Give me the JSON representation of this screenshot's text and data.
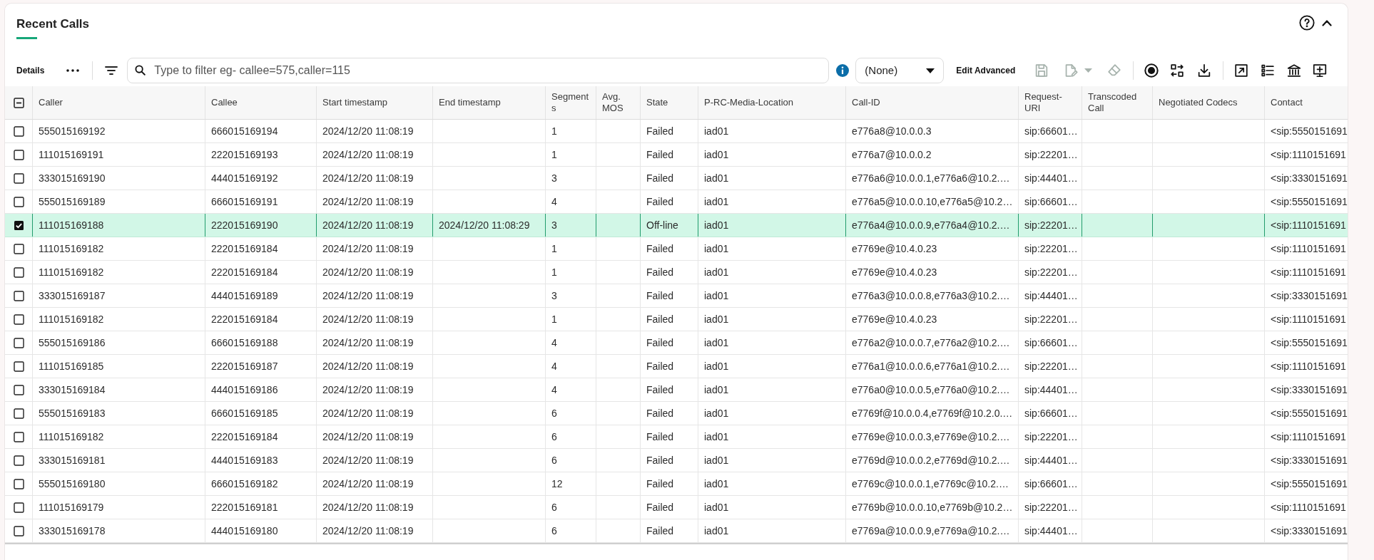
{
  "panel": {
    "title": "Recent Calls",
    "expanded": true
  },
  "toolbar": {
    "details_label": "Details",
    "filter": {
      "placeholder": "Type to filter eg- callee=575,caller=115"
    },
    "view_select": {
      "value": "(None)"
    },
    "edit_advanced": "Edit Advanced",
    "action_groups": [
      [
        {
          "kind": "save",
          "disabled": true,
          "menu": false
        },
        {
          "kind": "edit",
          "disabled": true,
          "menu": true
        },
        {
          "kind": "erase",
          "disabled": true,
          "menu": false
        }
      ],
      [
        {
          "kind": "record",
          "disabled": false,
          "menu": false
        },
        {
          "kind": "swap",
          "disabled": false,
          "menu": false
        },
        {
          "kind": "download",
          "disabled": false,
          "menu": false
        }
      ],
      [
        {
          "kind": "expand",
          "disabled": false,
          "menu": false
        },
        {
          "kind": "list",
          "disabled": false,
          "menu": false
        },
        {
          "kind": "bank",
          "disabled": false,
          "menu": false
        },
        {
          "kind": "add",
          "disabled": false,
          "menu": false
        }
      ]
    ]
  },
  "table": {
    "select_all": {
      "partial": true
    },
    "columns": [
      "Caller",
      "Callee",
      "Start timestamp",
      "End timestamp",
      "Segments",
      "Avg. MOS",
      "State",
      "P-RC-Media-Location",
      "Call-ID",
      "Request-URI",
      "Transcoded Call",
      "Negotiated Codecs",
      "Contact"
    ],
    "rows": [
      {
        "selected": false,
        "caller": "555015169192",
        "callee": "666015169194",
        "start_timestamp": "2024/12/20 11:08:19",
        "segments": "1",
        "state": "Failed",
        "p_rc_media_location": "iad01",
        "call_id": "e776a8@10.0.0.3",
        "request_uri": "sip:66601…",
        "contact": "<sip:5550151691"
      },
      {
        "selected": false,
        "caller": "111015169191",
        "callee": "222015169193",
        "start_timestamp": "2024/12/20 11:08:19",
        "segments": "1",
        "state": "Failed",
        "p_rc_media_location": "iad01",
        "call_id": "e776a7@10.0.0.2",
        "request_uri": "sip:22201…",
        "contact": "<sip:1110151691"
      },
      {
        "selected": false,
        "caller": "333015169190",
        "callee": "444015169192",
        "start_timestamp": "2024/12/20 11:08:19",
        "segments": "3",
        "state": "Failed",
        "p_rc_media_location": "iad01",
        "call_id": "e776a6@10.0.0.1,e776a6@10.2.…",
        "request_uri": "sip:44401…",
        "contact": "<sip:3330151691"
      },
      {
        "selected": false,
        "caller": "555015169189",
        "callee": "666015169191",
        "start_timestamp": "2024/12/20 11:08:19",
        "segments": "4",
        "state": "Failed",
        "p_rc_media_location": "iad01",
        "call_id": "e776a5@10.0.0.10,e776a5@10.2…",
        "request_uri": "sip:66601…",
        "contact": "<sip:5550151691"
      },
      {
        "selected": true,
        "caller": "111015169188",
        "callee": "222015169190",
        "start_timestamp": "2024/12/20 11:08:19",
        "end_timestamp": "2024/12/20 11:08:29",
        "segments": "3",
        "state": "Off-line",
        "p_rc_media_location": "iad01",
        "call_id": "e776a4@10.0.0.9,e776a4@10.2.…",
        "request_uri": "sip:22201…",
        "contact": "<sip:1110151691"
      },
      {
        "selected": false,
        "caller": "111015169182",
        "callee": "222015169184",
        "start_timestamp": "2024/12/20 11:08:19",
        "segments": "1",
        "state": "Failed",
        "p_rc_media_location": "iad01",
        "call_id": "e7769e@10.4.0.23",
        "request_uri": "sip:22201…",
        "contact": "<sip:1110151691"
      },
      {
        "selected": false,
        "caller": "111015169182",
        "callee": "222015169184",
        "start_timestamp": "2024/12/20 11:08:19",
        "segments": "1",
        "state": "Failed",
        "p_rc_media_location": "iad01",
        "call_id": "e7769e@10.4.0.23",
        "request_uri": "sip:22201…",
        "contact": "<sip:1110151691"
      },
      {
        "selected": false,
        "caller": "333015169187",
        "callee": "444015169189",
        "start_timestamp": "2024/12/20 11:08:19",
        "segments": "3",
        "state": "Failed",
        "p_rc_media_location": "iad01",
        "call_id": "e776a3@10.0.0.8,e776a3@10.2.…",
        "request_uri": "sip:44401…",
        "contact": "<sip:3330151691"
      },
      {
        "selected": false,
        "caller": "111015169182",
        "callee": "222015169184",
        "start_timestamp": "2024/12/20 11:08:19",
        "segments": "1",
        "state": "Failed",
        "p_rc_media_location": "iad01",
        "call_id": "e7769e@10.4.0.23",
        "request_uri": "sip:22201…",
        "contact": "<sip:1110151691"
      },
      {
        "selected": false,
        "caller": "555015169186",
        "callee": "666015169188",
        "start_timestamp": "2024/12/20 11:08:19",
        "segments": "4",
        "state": "Failed",
        "p_rc_media_location": "iad01",
        "call_id": "e776a2@10.0.0.7,e776a2@10.2.…",
        "request_uri": "sip:66601…",
        "contact": "<sip:5550151691"
      },
      {
        "selected": false,
        "caller": "111015169185",
        "callee": "222015169187",
        "start_timestamp": "2024/12/20 11:08:19",
        "segments": "4",
        "state": "Failed",
        "p_rc_media_location": "iad01",
        "call_id": "e776a1@10.0.0.6,e776a1@10.2.…",
        "request_uri": "sip:22201…",
        "contact": "<sip:1110151691"
      },
      {
        "selected": false,
        "caller": "333015169184",
        "callee": "444015169186",
        "start_timestamp": "2024/12/20 11:08:19",
        "segments": "4",
        "state": "Failed",
        "p_rc_media_location": "iad01",
        "call_id": "e776a0@10.0.0.5,e776a0@10.2.…",
        "request_uri": "sip:44401…",
        "contact": "<sip:3330151691"
      },
      {
        "selected": false,
        "caller": "555015169183",
        "callee": "666015169185",
        "start_timestamp": "2024/12/20 11:08:19",
        "segments": "6",
        "state": "Failed",
        "p_rc_media_location": "iad01",
        "call_id": "e7769f@10.0.0.4,e7769f@10.2.0.…",
        "request_uri": "sip:66601…",
        "contact": "<sip:5550151691"
      },
      {
        "selected": false,
        "caller": "111015169182",
        "callee": "222015169184",
        "start_timestamp": "2024/12/20 11:08:19",
        "segments": "6",
        "state": "Failed",
        "p_rc_media_location": "iad01",
        "call_id": "e7769e@10.0.0.3,e7769e@10.2.…",
        "request_uri": "sip:22201…",
        "contact": "<sip:1110151691"
      },
      {
        "selected": false,
        "caller": "333015169181",
        "callee": "444015169183",
        "start_timestamp": "2024/12/20 11:08:19",
        "segments": "6",
        "state": "Failed",
        "p_rc_media_location": "iad01",
        "call_id": "e7769d@10.0.0.2,e7769d@10.2.…",
        "request_uri": "sip:44401…",
        "contact": "<sip:3330151691"
      },
      {
        "selected": false,
        "caller": "555015169180",
        "callee": "666015169182",
        "start_timestamp": "2024/12/20 11:08:19",
        "segments": "12",
        "state": "Failed",
        "p_rc_media_location": "iad01",
        "call_id": "e7769c@10.0.0.1,e7769c@10.2.…",
        "request_uri": "sip:66601…",
        "contact": "<sip:5550151691"
      },
      {
        "selected": false,
        "caller": "111015169179",
        "callee": "222015169181",
        "start_timestamp": "2024/12/20 11:08:19",
        "segments": "6",
        "state": "Failed",
        "p_rc_media_location": "iad01",
        "call_id": "e7769b@10.0.0.10,e7769b@10.2…",
        "request_uri": "sip:22201…",
        "contact": "<sip:1110151691"
      },
      {
        "selected": false,
        "caller": "333015169178",
        "callee": "444015169180",
        "start_timestamp": "2024/12/20 11:08:19",
        "segments": "6",
        "state": "Failed",
        "p_rc_media_location": "iad01",
        "call_id": "e7769a@10.0.0.9,e7769a@10.2.…",
        "request_uri": "sip:44401…",
        "contact": "<sip:3330151691"
      }
    ]
  }
}
